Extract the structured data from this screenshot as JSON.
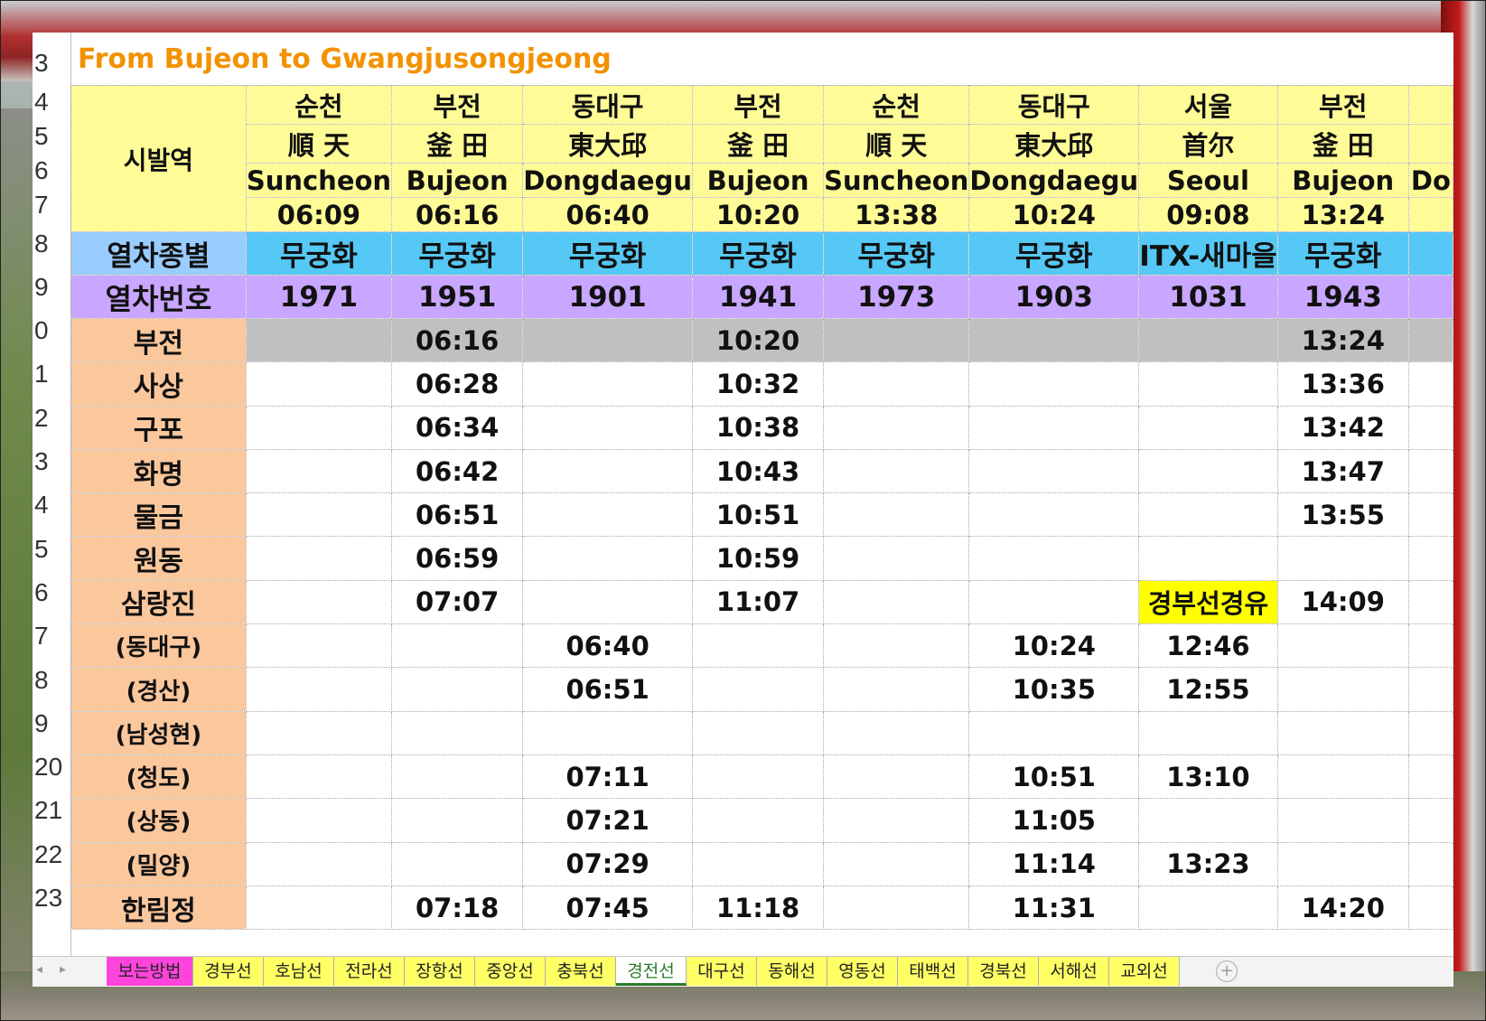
{
  "title": "From Bujeon to Gwangjusongjeong",
  "row_numbers": [
    "3",
    "4",
    "5",
    "6",
    "7",
    "8",
    "9",
    "0",
    "1",
    "2",
    "3",
    "4",
    "5",
    "6",
    "7",
    "8",
    "9",
    "20",
    "21",
    "22",
    "23"
  ],
  "labels": {
    "origin": "시발역",
    "train_type": "열차종별",
    "train_no": "열차번호"
  },
  "trains": [
    {
      "kr": "순천",
      "hanja": "順 天",
      "en": "Suncheon",
      "dep": "06:09",
      "type": "무궁화",
      "no": "1971"
    },
    {
      "kr": "부전",
      "hanja": "釜 田",
      "en": "Bujeon",
      "dep": "06:16",
      "type": "무궁화",
      "no": "1951"
    },
    {
      "kr": "동대구",
      "hanja": "東大邱",
      "en": "Dongdaegu",
      "dep": "06:40",
      "type": "무궁화",
      "no": "1901"
    },
    {
      "kr": "부전",
      "hanja": "釜 田",
      "en": "Bujeon",
      "dep": "10:20",
      "type": "무궁화",
      "no": "1941"
    },
    {
      "kr": "순천",
      "hanja": "順 天",
      "en": "Suncheon",
      "dep": "13:38",
      "type": "무궁화",
      "no": "1973"
    },
    {
      "kr": "동대구",
      "hanja": "東大邱",
      "en": "Dongdaegu",
      "dep": "10:24",
      "type": "무궁화",
      "no": "1903"
    },
    {
      "kr": "서울",
      "hanja": "首尔",
      "en": "Seoul",
      "dep": "09:08",
      "type": "ITX-새마을",
      "no": "1031"
    },
    {
      "kr": "부전",
      "hanja": "釜 田",
      "en": "Bujeon",
      "dep": "13:24",
      "type": "무궁화",
      "no": "1943"
    },
    {
      "kr": "",
      "hanja": "",
      "en": "Do",
      "dep": "",
      "type": "",
      "no": ""
    }
  ],
  "stations": [
    {
      "name": "부전",
      "times": [
        "",
        "06:16",
        "",
        "10:20",
        "",
        "",
        "",
        "13:24",
        ""
      ]
    },
    {
      "name": "사상",
      "times": [
        "",
        "06:28",
        "",
        "10:32",
        "",
        "",
        "",
        "13:36",
        ""
      ]
    },
    {
      "name": "구포",
      "times": [
        "",
        "06:34",
        "",
        "10:38",
        "",
        "",
        "",
        "13:42",
        ""
      ]
    },
    {
      "name": "화명",
      "times": [
        "",
        "06:42",
        "",
        "10:43",
        "",
        "",
        "",
        "13:47",
        ""
      ]
    },
    {
      "name": "물금",
      "times": [
        "",
        "06:51",
        "",
        "10:51",
        "",
        "",
        "",
        "13:55",
        ""
      ]
    },
    {
      "name": "원동",
      "times": [
        "",
        "06:59",
        "",
        "10:59",
        "",
        "",
        "",
        "",
        ""
      ]
    },
    {
      "name": "삼랑진",
      "times": [
        "",
        "07:07",
        "",
        "11:07",
        "",
        "",
        "경부선경유",
        "14:09",
        ""
      ]
    },
    {
      "name": "(동대구)",
      "times": [
        "",
        "",
        "06:40",
        "",
        "",
        "10:24",
        "12:46",
        "",
        ""
      ]
    },
    {
      "name": "(경산)",
      "times": [
        "",
        "",
        "06:51",
        "",
        "",
        "10:35",
        "12:55",
        "",
        ""
      ]
    },
    {
      "name": "(남성현)",
      "times": [
        "",
        "",
        "",
        "",
        "",
        "",
        "",
        "",
        ""
      ]
    },
    {
      "name": "(청도)",
      "times": [
        "",
        "",
        "07:11",
        "",
        "",
        "10:51",
        "13:10",
        "",
        ""
      ]
    },
    {
      "name": "(상동)",
      "times": [
        "",
        "",
        "07:21",
        "",
        "",
        "11:05",
        "",
        "",
        ""
      ]
    },
    {
      "name": "(밀양)",
      "times": [
        "",
        "",
        "07:29",
        "",
        "",
        "11:14",
        "13:23",
        "",
        ""
      ]
    },
    {
      "name": "한림정",
      "times": [
        "",
        "07:18",
        "07:45",
        "11:18",
        "",
        "11:31",
        "",
        "14:20",
        ""
      ]
    }
  ],
  "highlight_color": "#ffff00",
  "tabs": [
    "보는방법",
    "경부선",
    "호남선",
    "전라선",
    "장항선",
    "중앙선",
    "충북선",
    "경전선",
    "대구선",
    "동해선",
    "영동선",
    "태백선",
    "경북선",
    "서해선",
    "교외선"
  ],
  "active_tab": "경전선",
  "tab_nav": {
    "prev": "◂",
    "next": "▸"
  },
  "add_sheet_symbol": "+"
}
